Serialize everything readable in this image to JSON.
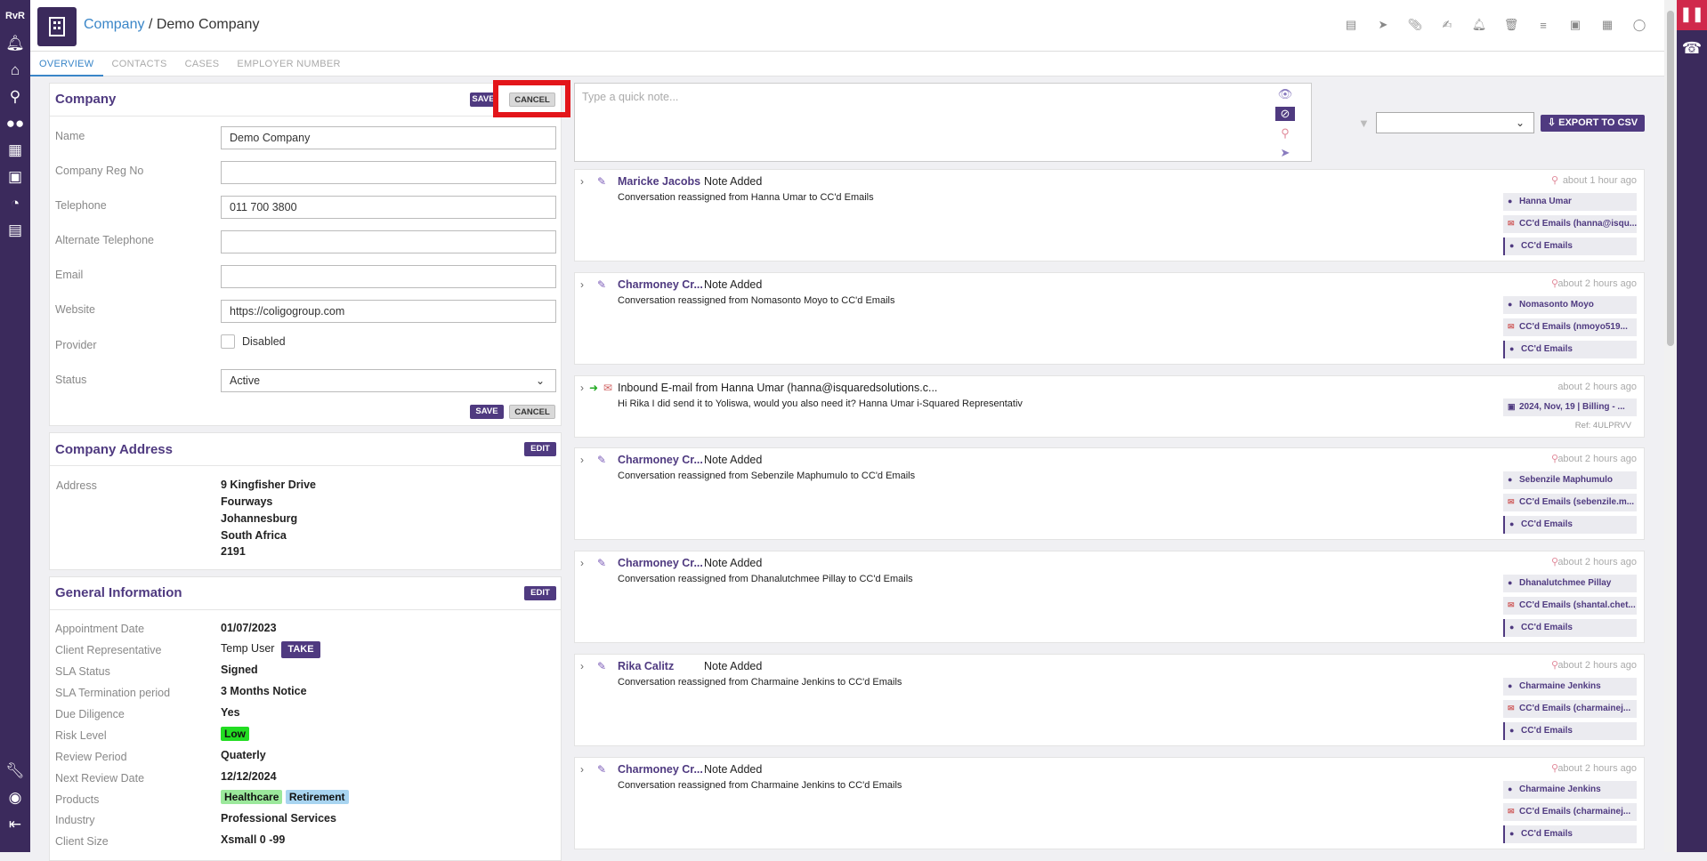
{
  "sidebar": {
    "logo": "RvR",
    "icons": [
      "bell-icon",
      "home-icon",
      "search-icon",
      "users-icon",
      "building-icon",
      "briefcase-icon",
      "chart-icon",
      "card-icon"
    ],
    "bottom_icons": [
      "wrench-icon",
      "lifebuoy-icon",
      "logout-icon"
    ]
  },
  "header": {
    "breadcrumb_link": "Company",
    "separator": "/",
    "current": "Demo Company"
  },
  "tabs": [
    "OVERVIEW",
    "CONTACTS",
    "CASES",
    "EMPLOYER NUMBER"
  ],
  "company": {
    "title": "Company",
    "save": "SAVE",
    "cancel": "CANCEL",
    "fields": [
      {
        "label": "Name",
        "value": ""
      },
      {
        "label": "Company Reg No",
        "value": ""
      },
      {
        "label": "Telephone",
        "value": ""
      },
      {
        "label": "Alternate Telephone",
        "value": ""
      },
      {
        "label": "Email",
        "value": ""
      },
      {
        "label": "Website",
        "value": ""
      }
    ],
    "values": [
      "Demo Company",
      "",
      "011 700 3800",
      "",
      "",
      "https://coligogroup.com"
    ],
    "provider_label": "Provider",
    "provider_checkbox": "Disabled",
    "status_label": "Status",
    "status_value": "Active"
  },
  "address": {
    "title": "Company Address",
    "edit": "EDIT",
    "label": "Address",
    "lines": [
      "9 Kingfisher Drive",
      "Fourways",
      "Johannesburg",
      "South Africa",
      "2191"
    ]
  },
  "general": {
    "title": "General Information",
    "edit": "EDIT",
    "rows": [
      {
        "label": "Appointment Date",
        "value": "01/07/2023"
      },
      {
        "label": "Client Representative",
        "value": "Temp User"
      },
      {
        "label": "SLA Status",
        "value": "Signed"
      },
      {
        "label": "SLA Termination period",
        "value": "3 Months Notice"
      },
      {
        "label": "Due Diligence",
        "value": "Yes"
      },
      {
        "label": "Risk Level",
        "value": "Low"
      },
      {
        "label": "Review Period",
        "value": "Quaterly"
      },
      {
        "label": "Next Review Date",
        "value": "12/12/2024"
      },
      {
        "label": "Products",
        "value": ""
      },
      {
        "label": "Industry",
        "value": "Professional Services"
      },
      {
        "label": "Client Size",
        "value": "Xsmall 0 -99"
      }
    ],
    "take": "TAKE",
    "products": [
      "Healthcare",
      "Retirement"
    ]
  },
  "note": {
    "placeholder": "Type a quick note..."
  },
  "export": {
    "label": "EXPORT TO CSV"
  },
  "feed": [
    {
      "author": "Maricke Jacobs",
      "action": "Note Added",
      "desc": "Conversation reassigned from Hanna Umar to CC'd Emails",
      "time": "about 1 hour ago",
      "chips": [
        "Hanna Umar",
        "CC'd Emails (hanna@isqu...",
        "CC'd Emails"
      ]
    },
    {
      "author": "Charmoney Cr...",
      "action": "Note Added",
      "desc": "Conversation reassigned from Nomasonto Moyo to CC'd Emails",
      "time": "about 2 hours ago",
      "chips": [
        "Nomasonto Moyo",
        "CC'd Emails (nmoyo519...",
        "CC'd Emails"
      ]
    },
    {
      "author": "Inbound E-mail from Hanna Umar (hanna@isquaredsolutions.c...",
      "action": "",
      "desc": "Hi Rika   I did send it to Yoliswa, would you also need it?   Hanna Umar i-Squared Representativ",
      "time": "about 2 hours ago",
      "chips": [
        "2024, Nov, 19 | Billing - ..."
      ],
      "ref": "Ref: 4ULPRVV"
    },
    {
      "author": "Charmoney Cr...",
      "action": "Note Added",
      "desc": "Conversation reassigned from Sebenzile Maphumulo to CC'd Emails",
      "time": "about 2 hours ago",
      "chips": [
        "Sebenzile Maphumulo",
        "CC'd Emails (sebenzile.m...",
        "CC'd Emails"
      ]
    },
    {
      "author": "Charmoney Cr...",
      "action": "Note Added",
      "desc": "Conversation reassigned from Dhanalutchmee Pillay to CC'd Emails",
      "time": "about 2 hours ago",
      "chips": [
        "Dhanalutchmee Pillay",
        "CC'd Emails (shantal.chet...",
        "CC'd Emails"
      ]
    },
    {
      "author": "Rika Calitz",
      "action": "Note Added",
      "desc": "Conversation reassigned from Charmaine Jenkins to CC'd Emails",
      "time": "about 2 hours ago",
      "chips": [
        "Charmaine Jenkins",
        "CC'd Emails (charmainej...",
        "CC'd Emails"
      ]
    },
    {
      "author": "Charmoney Cr...",
      "action": "Note Added",
      "desc": "Conversation reassigned from Charmaine Jenkins to CC'd Emails",
      "time": "about 2 hours ago",
      "chips": [
        "Charmaine Jenkins",
        "CC'd Emails (charmainej...",
        "CC'd Emails"
      ]
    }
  ]
}
